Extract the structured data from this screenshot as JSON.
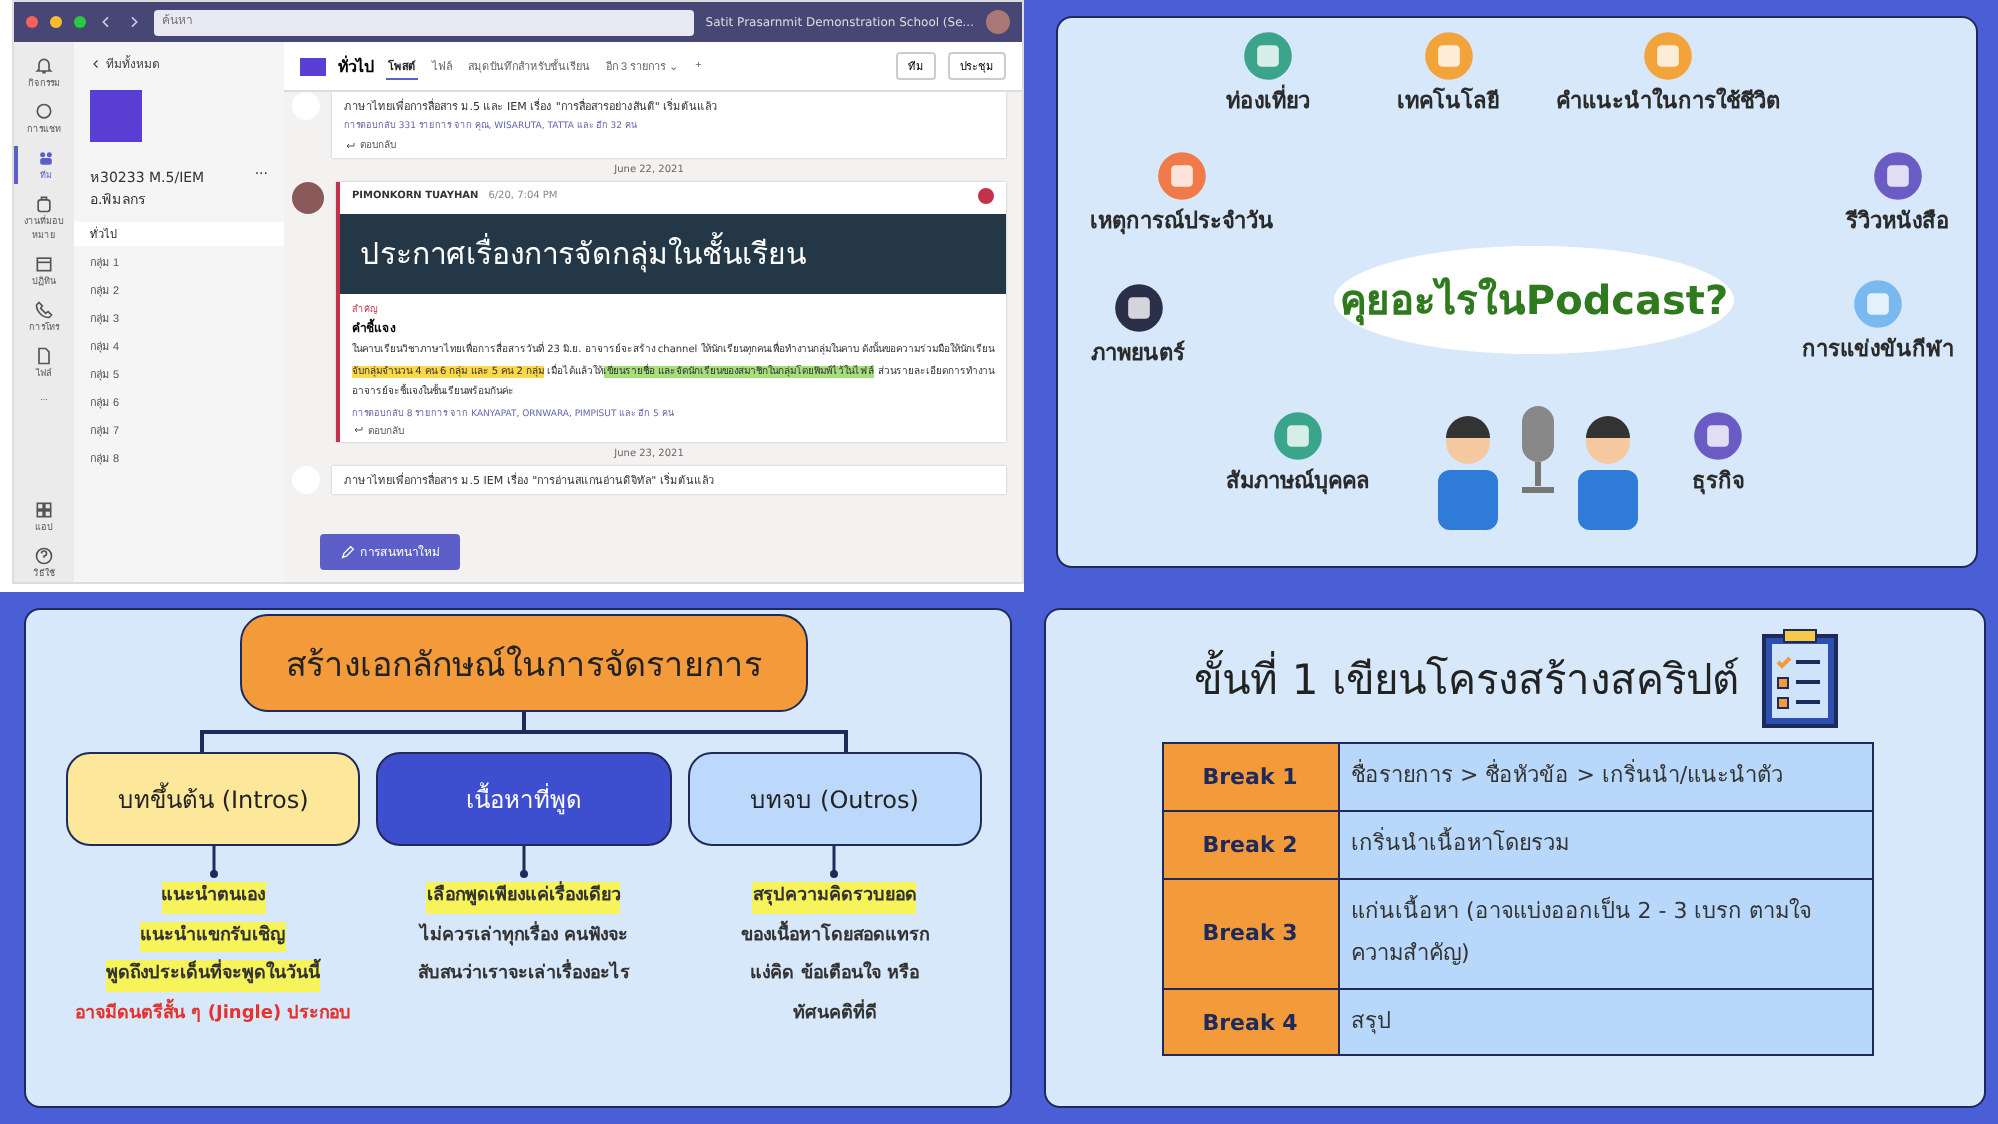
{
  "teams": {
    "search": {
      "placeholder": "ค้นหา"
    },
    "org": "Satit Prasarnmit Demonstration School (Se...",
    "rail": [
      {
        "label": "กิจกรรม",
        "selected": false
      },
      {
        "label": "การแชท",
        "selected": false
      },
      {
        "label": "ทีม",
        "selected": true
      },
      {
        "label": "งานที่มอบหมาย",
        "selected": false
      },
      {
        "label": "ปฏิทิน",
        "selected": false
      },
      {
        "label": "การโทร",
        "selected": false
      },
      {
        "label": "ไฟล์",
        "selected": false
      },
      {
        "label": "...",
        "selected": false
      },
      {
        "label": "แอป",
        "selected": false
      },
      {
        "label": "วิธีใช้",
        "selected": false
      }
    ],
    "back": "ทีมทั้งหมด",
    "team_name": "ห30233 M.5/IEM อ.พิมลกร",
    "team_more": "···",
    "channels": [
      {
        "label": "ทั่วไป",
        "selected": true
      },
      {
        "label": "กลุ่ม 1",
        "selected": false
      },
      {
        "label": "กลุ่ม 2",
        "selected": false
      },
      {
        "label": "กลุ่ม 3",
        "selected": false
      },
      {
        "label": "กลุ่ม 4",
        "selected": false
      },
      {
        "label": "กลุ่ม 5",
        "selected": false
      },
      {
        "label": "กลุ่ม 6",
        "selected": false
      },
      {
        "label": "กลุ่ม 7",
        "selected": false
      },
      {
        "label": "กลุ่ม 8",
        "selected": false
      }
    ],
    "channel_title": "ทั่วไป",
    "tabs": [
      {
        "label": "โพสต์",
        "selected": true
      },
      {
        "label": "ไฟล์",
        "selected": false
      },
      {
        "label": "สมุดบันทึกสำหรับชั้นเรียน",
        "selected": false
      },
      {
        "label": "อีก 3 รายการ ⌄",
        "selected": false
      }
    ],
    "tab_add": "+",
    "team_button": "ทีม",
    "meet_button": "ประชุม",
    "posts": [
      {
        "kind": "meeting",
        "title": "ภาษาไทยเพื่อการสื่อสาร ม.5 และ IEM เรื่อง \"การสื่อสารอย่างสันติ\" เริ่มต้นแล้ว",
        "replies": "การตอบกลับ 331 รายการ จาก คุณ, WISARUTA, TATTA และ อีก 32 คน",
        "reply": "ตอบกลับ"
      },
      {
        "kind": "date",
        "text": "June 22, 2021"
      },
      {
        "kind": "announcement",
        "author": "PIMONKORN TUAYHAN",
        "time": "6/20, 7:04 PM",
        "banner": "ประกาศเรื่องการจัดกลุ่มในชั้นเรียน",
        "important": "สำคัญ",
        "heading": "คำชี้แจง",
        "body": [
          {
            "text": "ในคาบเรียนวิชาภาษาไทยเพื่อการสื่อสารวันที่ 23 มิ.ย. อาจารย์จะสร้าง channel ให้นักเรียนทุกคนเพื่อทำงานกลุ่มในคาบ ดังนั้นขอความร่วมมือให้นักเรียน"
          },
          {
            "text": "จับกลุ่มจำนวน 4 คน 6 กลุ่ม และ 5 คน 2 กลุ่ม",
            "color": "#fbd74a"
          },
          {
            "text": " เมื่อได้แล้วให้"
          },
          {
            "text": "เขียนรายชื่อ และจัดนักเรียนของสมาชิกในกลุ่มโดยพิมพ์ไว้ในไฟล์",
            "color": "#a6e07a"
          },
          {
            "text": " ส่วนรายละเอียดการทำงานอาจารย์จะชี้แจงในชั้นเรียนพร้อมกันค่ะ"
          }
        ],
        "replies": "การตอบกลับ 8 รายการ จาก KANYAPAT, ORNWARA, PIMPISUT และ อีก 5 คน",
        "reply": "ตอบกลับ"
      },
      {
        "kind": "date",
        "text": "June 23, 2021"
      },
      {
        "kind": "meeting",
        "title": "ภาษาไทยเพื่อการสื่อสาร ม.5 IEM เรื่อง \"การอ่านสแกนอ่านดิจิทัล\" เริ่มต้นแล้ว"
      }
    ],
    "new_post": "การสนทนาใหม่"
  },
  "podcast": {
    "bubble": "คุยอะไรในPodcast?",
    "topics": [
      "ท่องเที่ยว",
      "เทคโนโลยี",
      "คำแนะนำในการใช้ชีวิต",
      "เหตุการณ์ประจำวัน",
      "รีวิวหนังสือ",
      "ภาพยนตร์",
      "การแข่งขันกีฬา",
      "สัมภาษณ์บุคคล",
      "ธุรกิจ"
    ]
  },
  "identity": {
    "title": "สร้างเอกลักษณ์ในการจัดรายการ",
    "branches": [
      {
        "label": "บทขึ้นต้น (Intros)",
        "color": "#fde79a",
        "lines": [
          {
            "kind": "highlight",
            "text": "แนะนำตนเอง"
          },
          {
            "kind": "highlight",
            "text": "แนะนำแขกรับเชิญ"
          },
          {
            "kind": "highlight",
            "text": "พูดถึงประเด็นที่จะพูดในวันนี้"
          },
          {
            "kind": "accent",
            "text": "อาจมีดนตรีสั้น ๆ (Jingle) ประกอบ"
          }
        ]
      },
      {
        "label": "เนื้อหาที่พูด",
        "color": "#3d4fcf",
        "lines": [
          {
            "kind": "highlight",
            "text": "เลือกพูดเพียงแค่เรื่องเดียว"
          },
          {
            "kind": "plain",
            "text": "ไม่ควรเล่าทุกเรื่อง คนฟังจะ"
          },
          {
            "kind": "plain",
            "text": "สับสนว่าเราจะเล่าเรื่องอะไร"
          }
        ]
      },
      {
        "label": "บทจบ (Outros)",
        "color": "#bcd9fb",
        "lines": [
          {
            "kind": "highlight",
            "text": "สรุปความคิดรวบยอด"
          },
          {
            "kind": "plain",
            "text": "ของเนื้อหาโดยสอดแทรก"
          },
          {
            "kind": "plain",
            "text": "แง่คิด ข้อเตือนใจ หรือ"
          },
          {
            "kind": "plain",
            "text": "ทัศนคติที่ดี"
          }
        ]
      }
    ]
  },
  "script": {
    "title": "ขั้นที่ 1 เขียนโครงสร้างสคริปต์",
    "rows": [
      {
        "label": "Break 1",
        "text": "ชื่อรายการ > ชื่อหัวข้อ > เกริ่นนำ/แนะนำตัว"
      },
      {
        "label": "Break 2",
        "text": "เกริ่นนำเนื้อหาโดยรวม"
      },
      {
        "label": "Break 3",
        "text": "แก่นเนื้อหา (อาจแบ่งออกเป็น 2 - 3 เบรก ตามใจความสำคัญ)"
      },
      {
        "label": "Break 4",
        "text": "สรุป"
      }
    ]
  }
}
